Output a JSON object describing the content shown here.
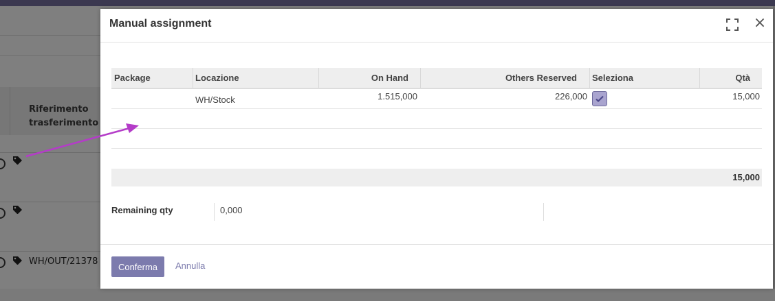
{
  "background": {
    "header_label": "Riferimento trasferimento",
    "rows": [
      {
        "reference": ""
      },
      {
        "reference": ""
      },
      {
        "reference": "WH/OUT/21378"
      }
    ]
  },
  "modal": {
    "title": "Manual assignment",
    "columns": [
      "Package",
      "Locazione",
      "On Hand",
      "Others Reserved",
      "Seleziona",
      "Qtà"
    ],
    "rows": [
      {
        "package": "",
        "location": "WH/Stock",
        "on_hand": "1.515,000",
        "others_reserved": "226,000",
        "selected": true,
        "qty": "15,000"
      }
    ],
    "total_qty": "15,000",
    "remaining_label": "Remaining qty",
    "remaining_value": "0,000",
    "confirm_label": "Conferma",
    "cancel_label": "Annulla"
  },
  "colors": {
    "accent": "#7c7bad",
    "annotation_arrow": "#b43cc8"
  },
  "icons": {
    "expand": "expand-icon",
    "close": "close-icon",
    "tag": "tags-icon",
    "check": "check-icon"
  }
}
